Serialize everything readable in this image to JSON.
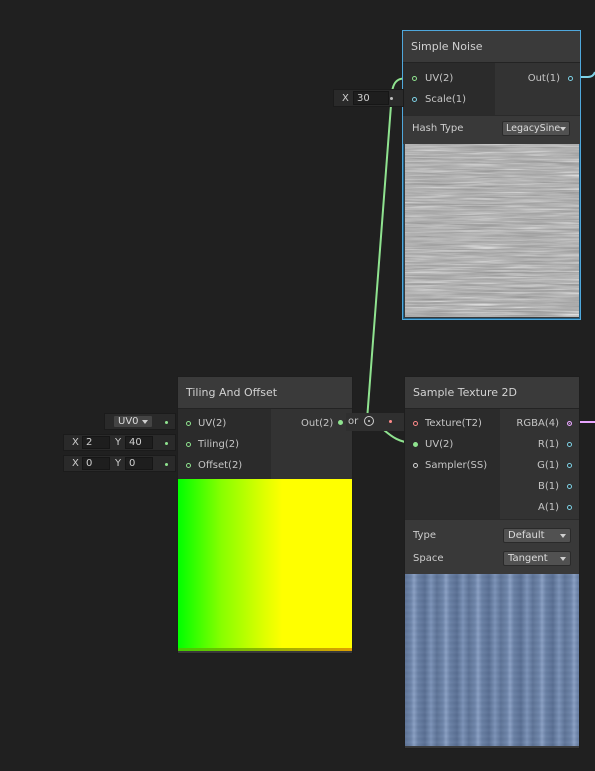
{
  "simple_noise": {
    "title": "Simple Noise",
    "inputs": [
      {
        "label": "UV(2)"
      },
      {
        "label": "Scale(1)"
      }
    ],
    "output": "Out(1)",
    "scale_field": {
      "axis": "X",
      "value": "30"
    },
    "hash_type_label": "Hash Type",
    "hash_type_value": "LegacySine"
  },
  "tiling_offset": {
    "title": "Tiling And Offset",
    "inputs": [
      {
        "label": "UV(2)"
      },
      {
        "label": "Tiling(2)"
      },
      {
        "label": "Offset(2)"
      }
    ],
    "output": "Out(2)",
    "uv_dropdown": "UV0",
    "tiling_field": {
      "x_label": "X",
      "x": "2",
      "y_label": "Y",
      "y": "40"
    },
    "offset_field": {
      "x_label": "X",
      "x": "0",
      "y_label": "Y",
      "y": "0"
    }
  },
  "sample_texture": {
    "title": "Sample Texture 2D",
    "inputs": [
      {
        "label": "Texture(T2)"
      },
      {
        "label": "UV(2)"
      },
      {
        "label": "Sampler(SS)"
      }
    ],
    "outputs": [
      {
        "label": "RGBA(4)"
      },
      {
        "label": "R(1)"
      },
      {
        "label": "G(1)"
      },
      {
        "label": "B(1)"
      },
      {
        "label": "A(1)"
      }
    ],
    "type_label": "Type",
    "type_value": "Default",
    "space_label": "Space",
    "space_value": "Tangent"
  },
  "partial_node": {
    "label_fragment": "or"
  },
  "colors": {
    "canvas": "#202020",
    "node_body": "#393939",
    "selection": "#4fa8dc",
    "edge_vector2": "#8fe38f",
    "edge_float": "#7ed2e6",
    "edge_vector4": "#e8a6ff",
    "texture_port": "#ff8a8a"
  }
}
